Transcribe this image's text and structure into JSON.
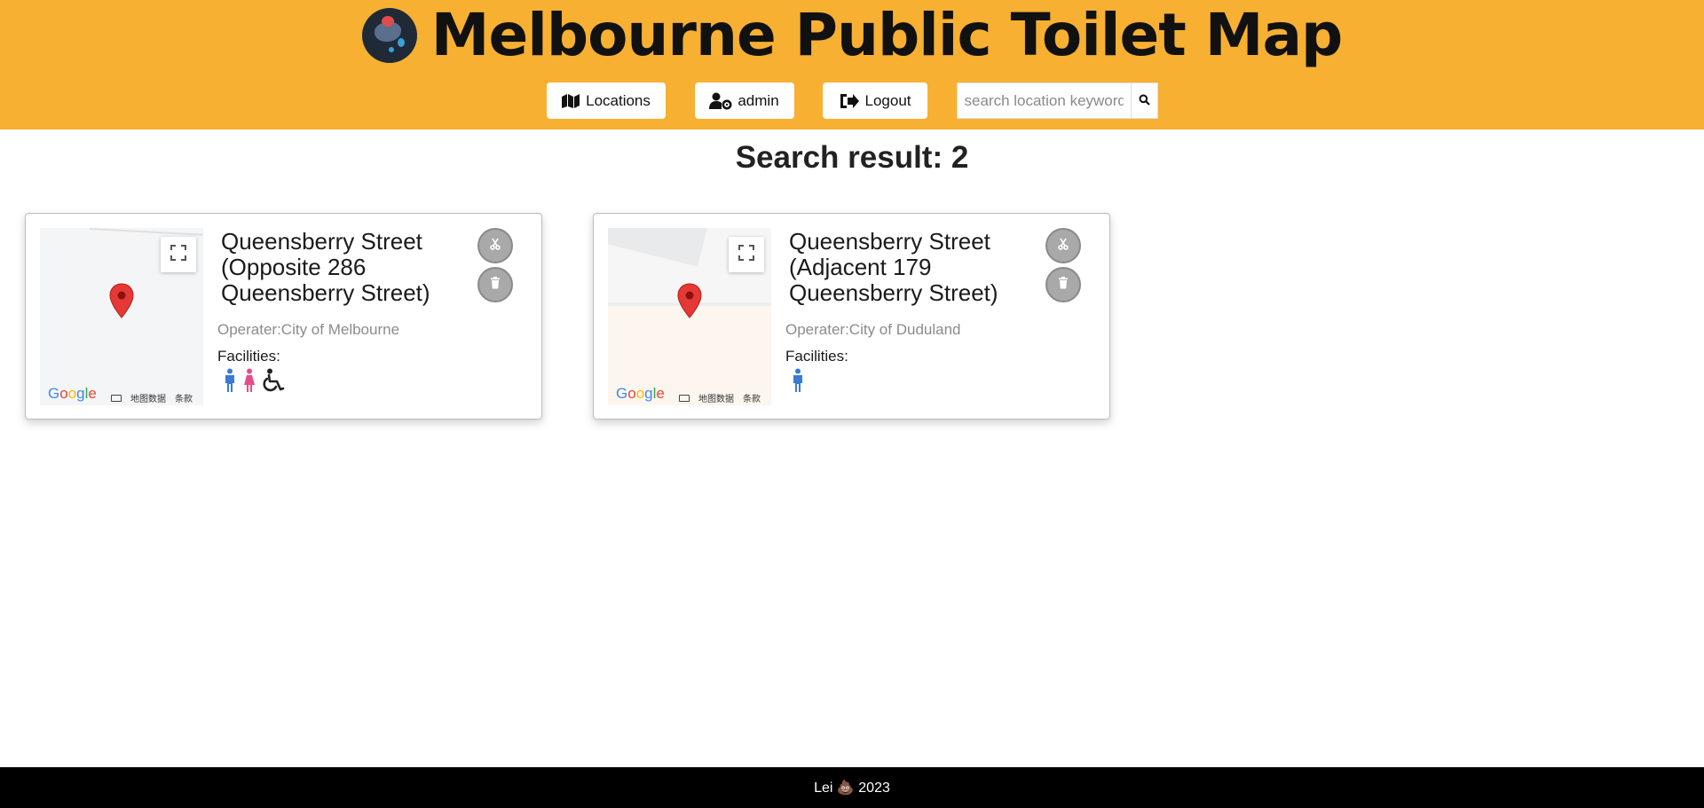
{
  "app": {
    "title": "Melbourne Public Toilet Map"
  },
  "nav": {
    "locations_label": "Locations",
    "admin_label": "admin",
    "logout_label": "Logout",
    "search_placeholder": "search location keywords"
  },
  "results": {
    "heading": "Search result: 2",
    "items": [
      {
        "name": "Queensberry Street (Opposite 286 Queensberry Street)",
        "operator": "Operater:City of Melbourne",
        "facilities_label": "Facilities:",
        "facilities": [
          "male-icon",
          "female-icon",
          "wheelchair-icon"
        ]
      },
      {
        "name": "Queensberry Street (Adjacent 179 Queensberry Street)",
        "operator": "Operater:City of Duduland",
        "facilities_label": "Facilities:",
        "facilities": [
          "male-icon"
        ]
      }
    ]
  },
  "map": {
    "google_label": "Google",
    "map_data_label": "地图数据",
    "terms_label": "条款"
  },
  "colors": {
    "header_bg": "#f7b032",
    "pin": "#e53935",
    "male": "#3a7bd5",
    "female": "#e84c88",
    "footer_bg": "#000000"
  },
  "footer": {
    "text": "Lei 💩 2023"
  }
}
